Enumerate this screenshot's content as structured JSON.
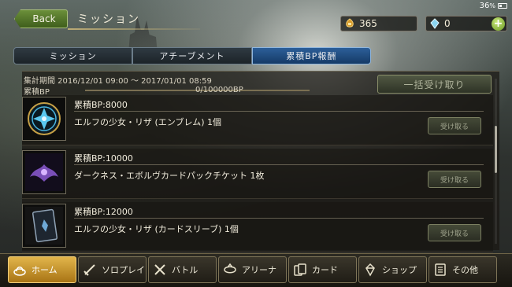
{
  "status": {
    "battery": "36",
    "battery_unit": "%"
  },
  "header": {
    "back_label": "Back",
    "title": "ミッション",
    "gold": "365",
    "crystals": "0",
    "add_label": "+"
  },
  "tabs": [
    {
      "label": "ミッション"
    },
    {
      "label": "アチーブメント"
    },
    {
      "label": "累積BP報酬"
    }
  ],
  "panel": {
    "period": "集計期間 2016/12/01 09:00 ～ 2017/01/01 08:59",
    "bp_label": "累積BP",
    "bp_value": "0/100000BP",
    "bp_progress": 0,
    "bulk_claim_label": "一括受け取り"
  },
  "missions": [
    {
      "title": "累積BP:8000",
      "reward": "エルフの少女・リザ (エンブレム) 1個",
      "claim_label": "受け取る",
      "icon": "emblem-icon"
    },
    {
      "title": "累積BP:10000",
      "reward": "ダークネス・エボルヴカードパックチケット 1枚",
      "claim_label": "受け取る",
      "icon": "pack-ticket-icon"
    },
    {
      "title": "累積BP:12000",
      "reward": "エルフの少女・リザ (カードスリーブ) 1個",
      "claim_label": "受け取る",
      "icon": "card-sleeve-icon"
    }
  ],
  "nav": [
    {
      "label": "ホーム",
      "icon": "home-icon"
    },
    {
      "label": "ソロプレイ",
      "icon": "sword-icon"
    },
    {
      "label": "バトル",
      "icon": "crossed-swords-icon"
    },
    {
      "label": "アリーナ",
      "icon": "arena-icon"
    },
    {
      "label": "カード",
      "icon": "cards-icon"
    },
    {
      "label": "ショップ",
      "icon": "shop-icon"
    },
    {
      "label": "その他",
      "icon": "menu-icon"
    }
  ]
}
